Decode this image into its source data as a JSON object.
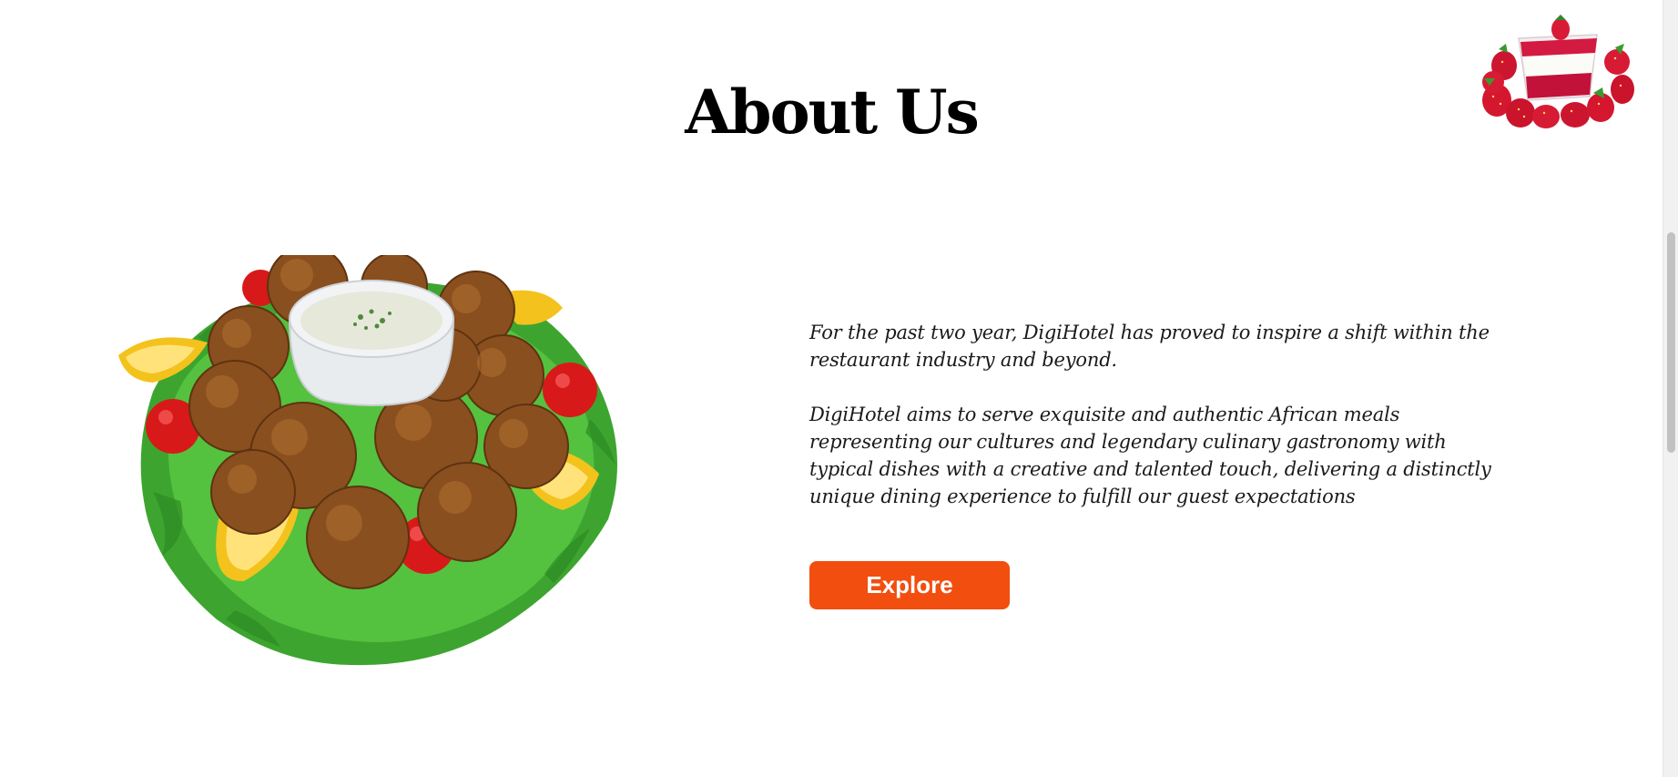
{
  "about": {
    "title": "About Us",
    "paragraphs": [
      "For the past two year, DigiHotel has proved to inspire a shift within the restaurant industry and beyond.",
      "DigiHotel aims to serve exquisite and authentic African meals representing our cultures and legendary culinary gastronomy with typical dishes with a creative and talented touch, delivering a distinctly unique dining experience to fulfill our guest expectations"
    ],
    "explore_label": "Explore"
  },
  "colors": {
    "accent": "#f24e0f",
    "text": "#1a1a1a",
    "background": "#ffffff"
  },
  "images": {
    "main": "falafel-plate-image",
    "corner": "strawberry-dessert-image"
  }
}
